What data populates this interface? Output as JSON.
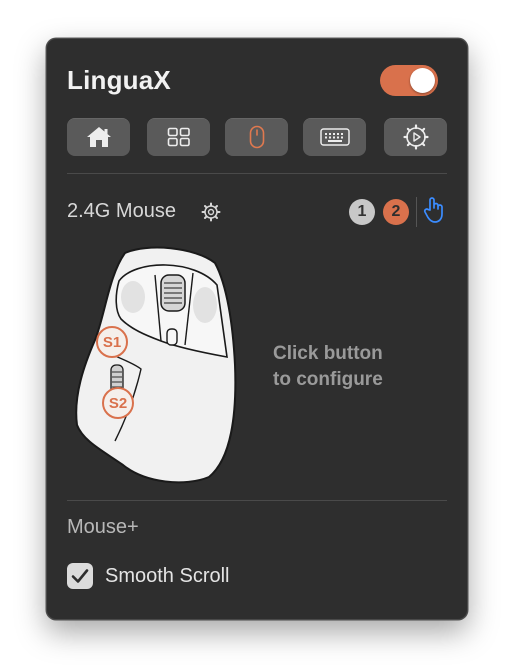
{
  "app": {
    "title": "LinguaX",
    "enabled": true
  },
  "tabs": [
    {
      "name": "home",
      "icon": "home-icon",
      "active": false
    },
    {
      "name": "grid",
      "icon": "grid-icon",
      "active": false
    },
    {
      "name": "mouse",
      "icon": "mouse-icon",
      "active": true
    },
    {
      "name": "keyboard",
      "icon": "keyboard-icon",
      "active": false
    },
    {
      "name": "settings",
      "icon": "gear-icon",
      "active": false
    }
  ],
  "device": {
    "name": "2.4G Mouse",
    "slots": [
      "1",
      "2"
    ],
    "active_slot": "2",
    "button_labels": {
      "s1": "S1",
      "s2": "S2"
    }
  },
  "hint": {
    "line1": "Click button",
    "line2": "to configure"
  },
  "mouse_plus": {
    "title": "Mouse+",
    "smooth_scroll_label": "Smooth Scroll",
    "smooth_scroll_checked": true
  },
  "colors": {
    "accent": "#d9714c",
    "link_blue": "#3b8cff",
    "panel": "#2e2e2e"
  }
}
